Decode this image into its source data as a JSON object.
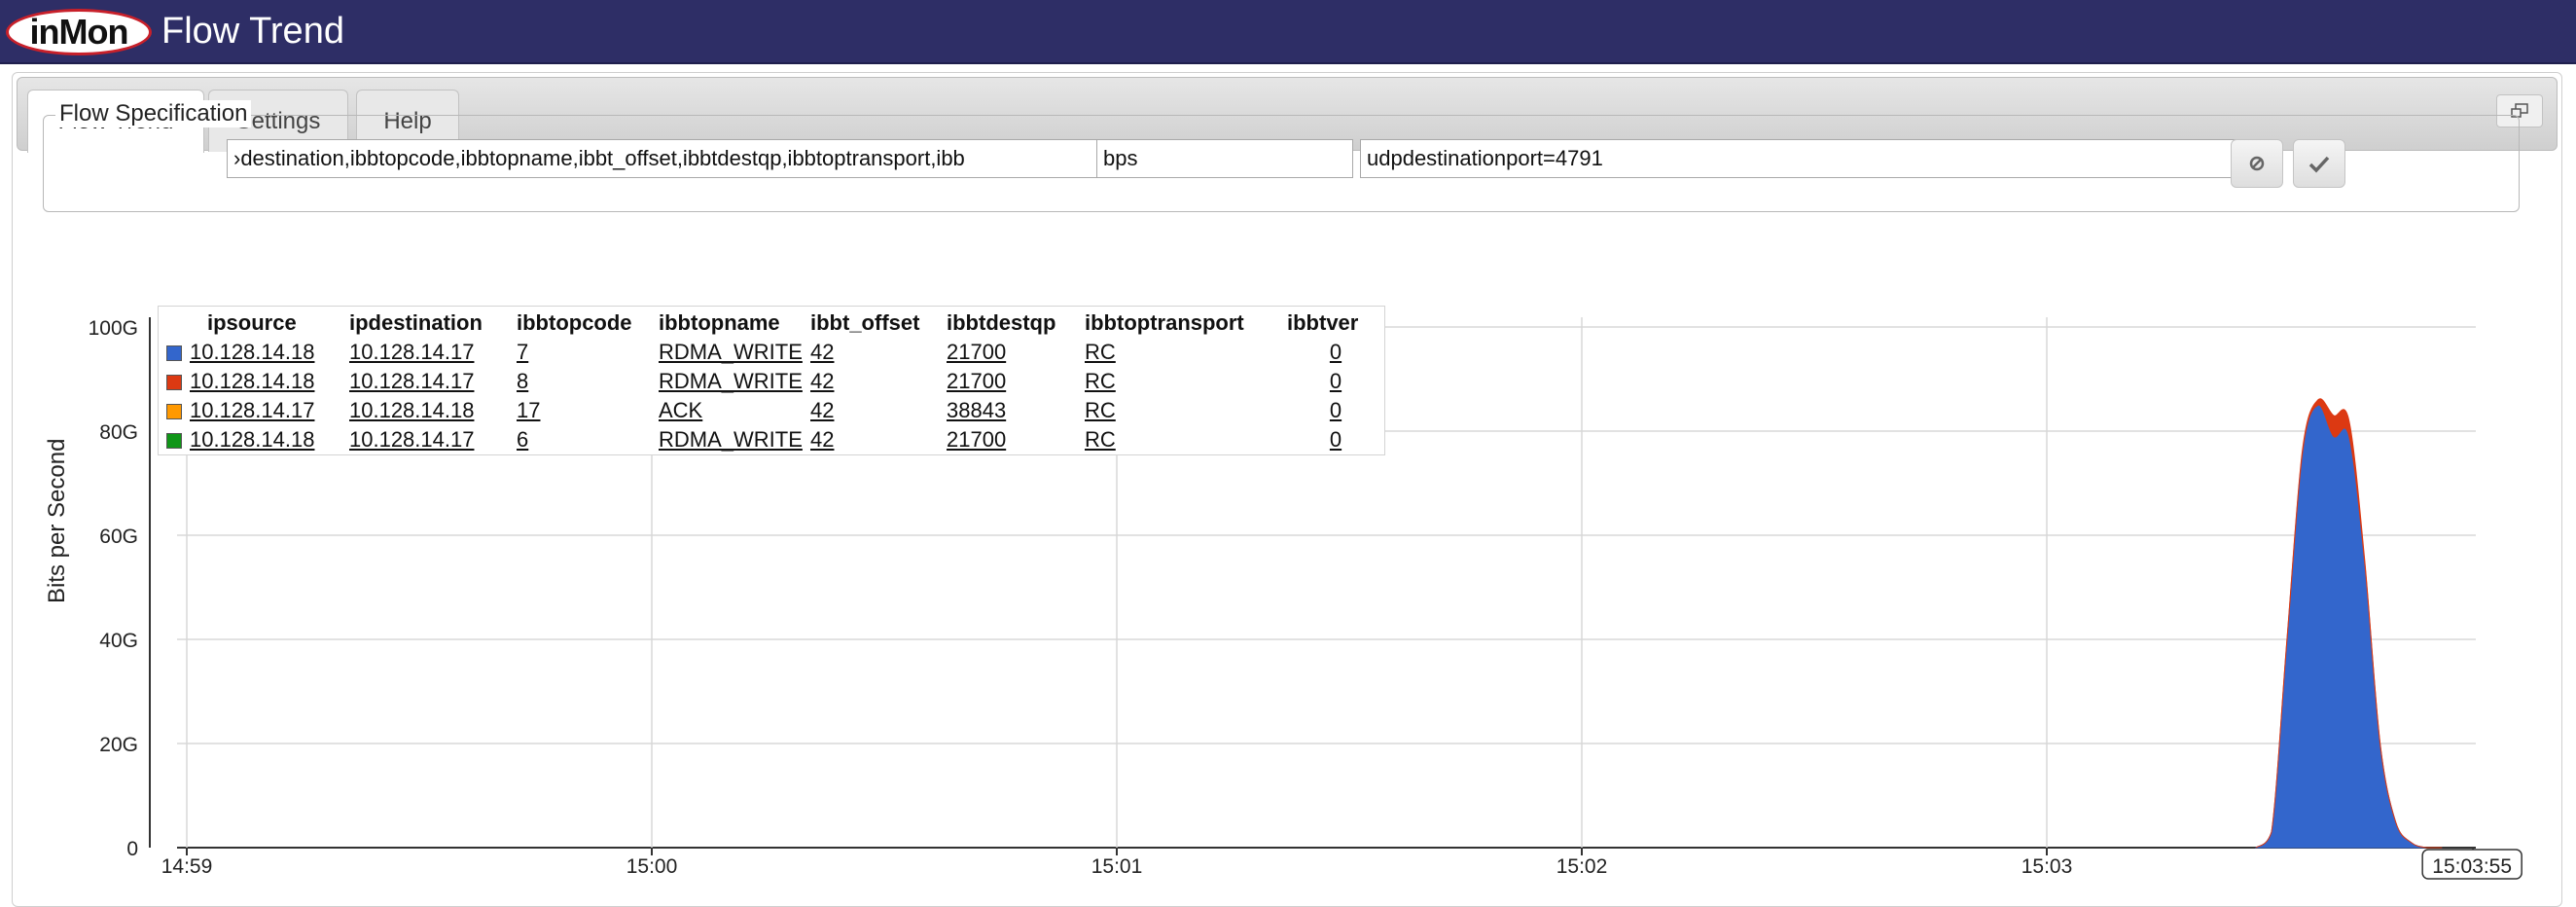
{
  "app": {
    "logo_text": "inMon",
    "title": "Flow Trend"
  },
  "tabs": [
    {
      "label": "Flow Trend",
      "active": true
    },
    {
      "label": "Settings",
      "active": false
    },
    {
      "label": "Help",
      "active": false
    }
  ],
  "flow_spec": {
    "legend": "Flow Specification",
    "keys_value": "›destination,ibbtopcode,ibbtopname,ibbt_offset,ibbtdestqp,ibbtoptransport,ibb",
    "value_value": "bps",
    "filter_value": "udpdestinationport=4791",
    "clear_icon": "clear-icon",
    "submit_icon": "checkmark-icon"
  },
  "legend_table": {
    "headers": [
      "ipsource",
      "ipdestination",
      "ibbtopcode",
      "ibbtopname",
      "ibbt_offset",
      "ibbtdestqp",
      "ibbtoptransport",
      "ibbtver"
    ],
    "rows": [
      {
        "color": "#3366cc",
        "cells": [
          "10.128.14.18",
          "10.128.14.17",
          "7",
          "RDMA_WRITE",
          "42",
          "21700",
          "RC",
          "0"
        ]
      },
      {
        "color": "#dc3912",
        "cells": [
          "10.128.14.18",
          "10.128.14.17",
          "8",
          "RDMA_WRITE",
          "42",
          "21700",
          "RC",
          "0"
        ]
      },
      {
        "color": "#ff9900",
        "cells": [
          "10.128.14.17",
          "10.128.14.18",
          "17",
          "ACK",
          "42",
          "38843",
          "RC",
          "0"
        ]
      },
      {
        "color": "#109618",
        "cells": [
          "10.128.14.18",
          "10.128.14.17",
          "6",
          "RDMA_WRITE",
          "42",
          "21700",
          "RC",
          "0"
        ]
      }
    ]
  },
  "chart_data": {
    "type": "area",
    "ylabel": "Bits per Second",
    "yticks": [
      "0",
      "20G",
      "40G",
      "60G",
      "80G",
      "100G"
    ],
    "ylim": [
      0,
      100
    ],
    "xticks": [
      "14:59",
      "15:00",
      "15:01",
      "15:02",
      "15:03",
      "15:03:55"
    ],
    "grid": true,
    "legend_position": "top-left",
    "series": [
      {
        "color": "#3366cc",
        "x": [
          "15:03:27",
          "15:03:29",
          "15:03:31",
          "15:03:33",
          "15:03:35",
          "15:03:37",
          "15:03:39",
          "15:03:41",
          "15:03:43",
          "15:03:45",
          "15:03:47",
          "15:03:49",
          "15:03:51"
        ],
        "values": [
          0,
          3,
          40,
          76,
          85,
          79,
          79,
          55,
          20,
          5,
          1,
          0,
          0
        ]
      },
      {
        "color": "#dc3912",
        "x": [
          "15:03:27",
          "15:03:29",
          "15:03:31",
          "15:03:33",
          "15:03:35",
          "15:03:37",
          "15:03:39",
          "15:03:41",
          "15:03:43",
          "15:03:45",
          "15:03:47",
          "15:03:49",
          "15:03:51"
        ],
        "values": [
          0,
          0,
          0.2,
          0.5,
          1,
          4,
          3,
          0.5,
          0.2,
          0,
          0,
          0,
          0
        ]
      }
    ]
  }
}
